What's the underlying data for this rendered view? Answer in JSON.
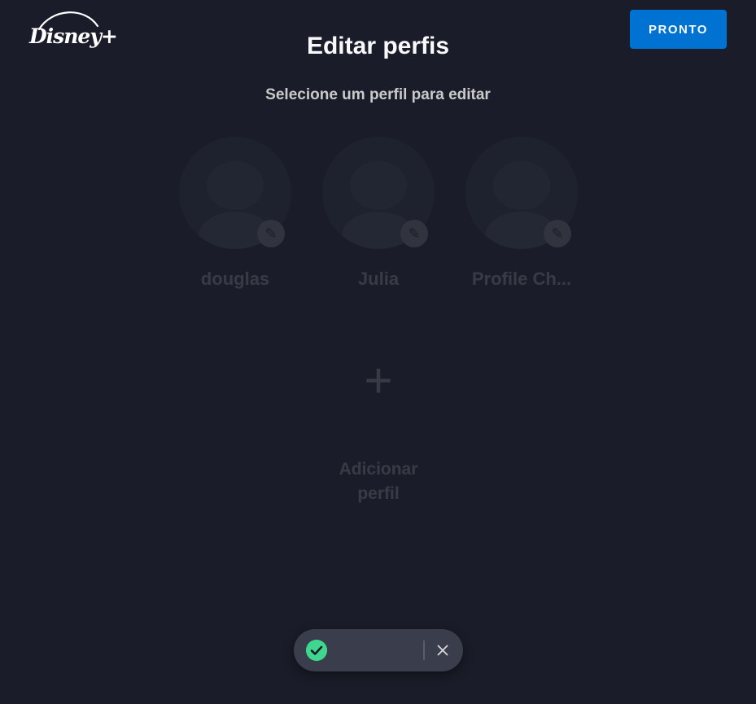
{
  "header": {
    "logo_text": "Disney+",
    "done_label": "PRONTO"
  },
  "main": {
    "title": "Editar perfis",
    "subtitle": "Selecione um perfil para editar",
    "profiles": [
      {
        "name": "douglas"
      },
      {
        "name": "Julia"
      },
      {
        "name": "Profile Ch..."
      }
    ],
    "add_profile_label": "Adicionar perfil"
  },
  "toast": {
    "message": ""
  },
  "colors": {
    "background": "#1a1d29",
    "accent": "#0072d2",
    "success": "#3fd68e"
  },
  "icons": {
    "edit": "pencil-icon",
    "add": "plus-icon",
    "success": "check-circle-icon",
    "close": "close-icon"
  }
}
